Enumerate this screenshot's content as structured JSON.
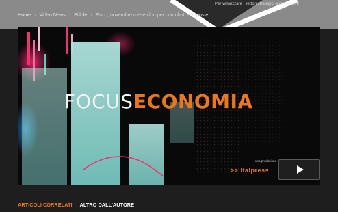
{
  "header_overlay": {
    "snippet_text": "Per valorizzare i settori strategici regione dove"
  },
  "breadcrumb": {
    "items": [
      "Home",
      "Video News",
      "Pillole",
      "Fisco, novembre mese clou per contributi e imposte"
    ],
    "separator": "›"
  },
  "video": {
    "title_part1": "FOCUS",
    "title_part2": "ECONOMIA",
    "producer_label": "una produzione",
    "producer_brand": ">> Italpress",
    "play_icon": "play-icon"
  },
  "tabs": {
    "items": [
      {
        "label": "ARTICOLI CORRELATI",
        "active": true
      },
      {
        "label": "ALTRO DALL'AUTORE",
        "active": false
      }
    ]
  },
  "colors": {
    "accent": "#e87722",
    "page_background": "#1e1e1e",
    "text_light": "#f2f2f2"
  }
}
